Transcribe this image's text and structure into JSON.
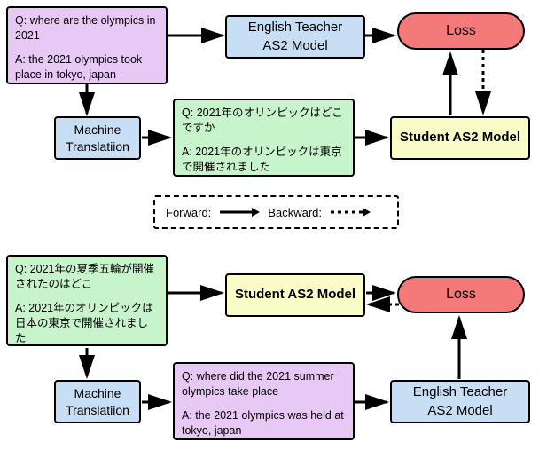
{
  "top": {
    "english_qa": {
      "q_label": "Q:",
      "q_text": "where are the olympics in 2021",
      "a_label": "A:",
      "a_text": "the 2021 olympics took place in tokyo, japan"
    },
    "mt_label": "Machine Translatiion",
    "translated_qa": {
      "q_label": "Q:",
      "q_text": "2021年のオリンピックはどこですか",
      "a_label": "A:",
      "a_text": "2021年のオリンピックは東京で開催されました"
    },
    "teacher_label": "English Teacher AS2 Model",
    "student_label": "Student AS2 Model",
    "loss_label": "Loss"
  },
  "legend": {
    "forward": "Forward:",
    "backward": "Backward:"
  },
  "bottom": {
    "japanese_qa": {
      "q_label": "Q:",
      "q_text": "2021年の夏季五輪が開催されたのはどこ",
      "a_label": "A:",
      "a_text": "2021年のオリンピックは日本の東京で開催されました"
    },
    "mt_label": "Machine Translatiion",
    "translated_qa": {
      "q_label": "Q:",
      "q_text": "where did the 2021 summer olympics take place",
      "a_label": "A:",
      "a_text": "the 2021 olympics was held at tokyo, japan"
    },
    "student_label": "Student AS2 Model",
    "teacher_label": "English Teacher AS2 Model",
    "loss_label": "Loss"
  }
}
